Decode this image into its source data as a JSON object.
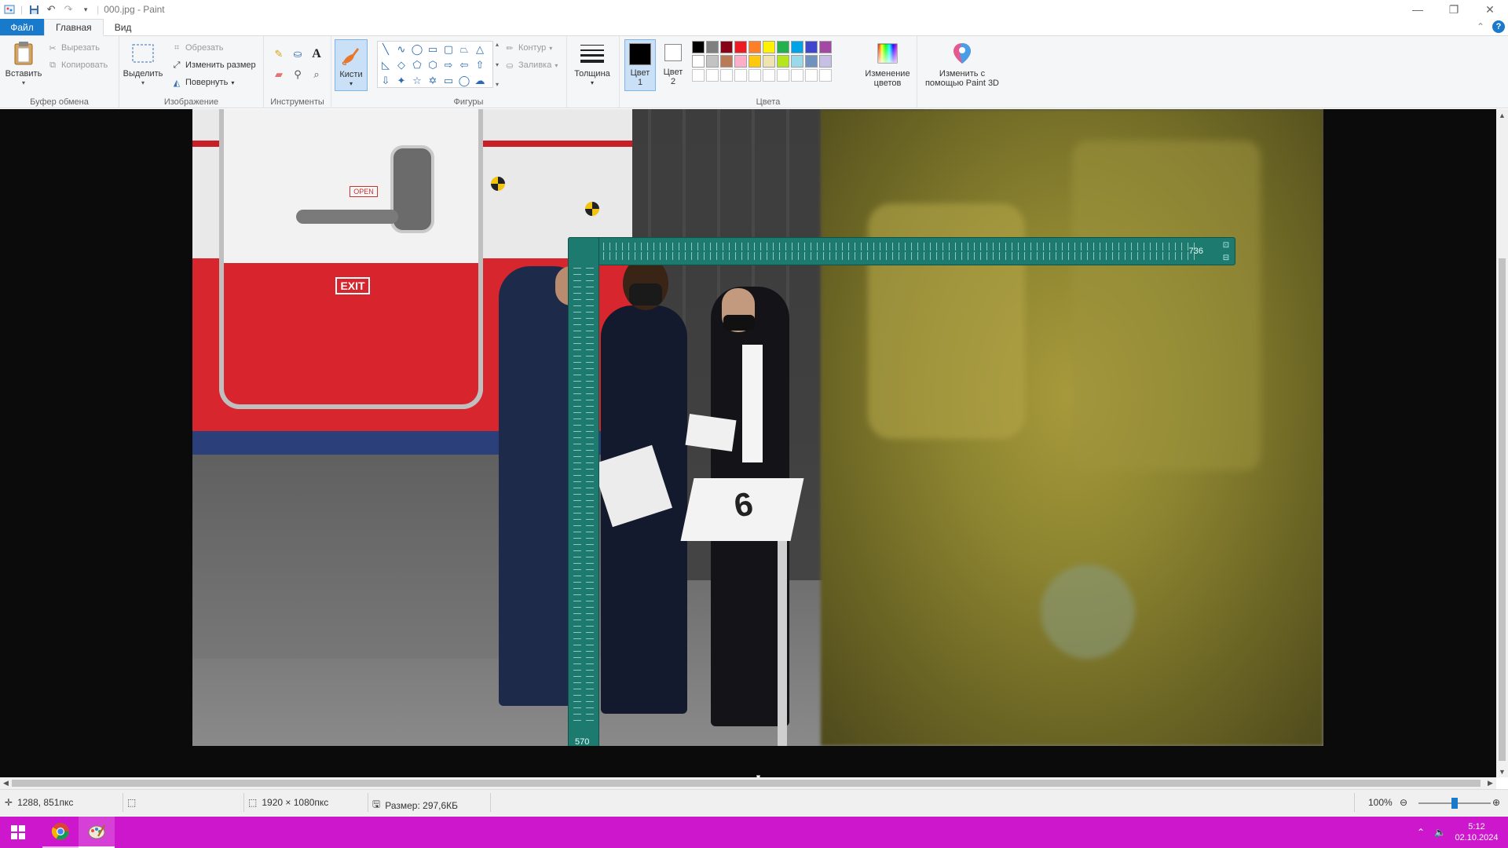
{
  "window": {
    "title": "000.jpg - Paint"
  },
  "menu": {
    "file": "Файл",
    "home": "Главная",
    "view": "Вид"
  },
  "ribbon": {
    "clipboard": {
      "paste": "Вставить",
      "cut": "Вырезать",
      "copy": "Копировать",
      "label": "Буфер обмена"
    },
    "image": {
      "select": "Выделить",
      "crop": "Обрезать",
      "resize": "Изменить размер",
      "rotate": "Повернуть",
      "label": "Изображение"
    },
    "tools": {
      "label": "Инструменты"
    },
    "brushes": {
      "label": "Кисти"
    },
    "shapes": {
      "outline": "Контур",
      "fill": "Заливка",
      "label": "Фигуры"
    },
    "thickness": {
      "label": "Толщина"
    },
    "colors": {
      "color1": "Цвет",
      "color1_num": "1",
      "color2": "Цвет",
      "color2_num": "2",
      "edit_colors_line1": "Изменение",
      "edit_colors_line2": "цветов",
      "label": "Цвета",
      "row1": [
        "#000000",
        "#7f7f7f",
        "#880015",
        "#ed1c24",
        "#ff7f27",
        "#fff200",
        "#22b14c",
        "#00a2e8",
        "#3f48cc",
        "#a349a4"
      ],
      "row2": [
        "#ffffff",
        "#c3c3c3",
        "#b97a57",
        "#ffaec9",
        "#ffc90e",
        "#efe4b0",
        "#b5e61d",
        "#99d9ea",
        "#7092be",
        "#c8bfe7"
      ]
    },
    "paint3d": {
      "line1": "Изменить с",
      "line2": "помощью Paint 3D"
    }
  },
  "ruler": {
    "horizontal_value": "736",
    "vertical_value": "570"
  },
  "photo": {
    "exit_sign": "EXIT",
    "open_sign": "OPEN",
    "stand_number": "6"
  },
  "status": {
    "cursor": "1288, 851пкс",
    "dimensions": "1920 × 1080пкс",
    "size": "Размер: 297,6КБ",
    "zoom": "100%",
    "zoom_level": 0.5
  },
  "taskbar": {
    "time": "5:12",
    "date": "02.10.2024"
  }
}
